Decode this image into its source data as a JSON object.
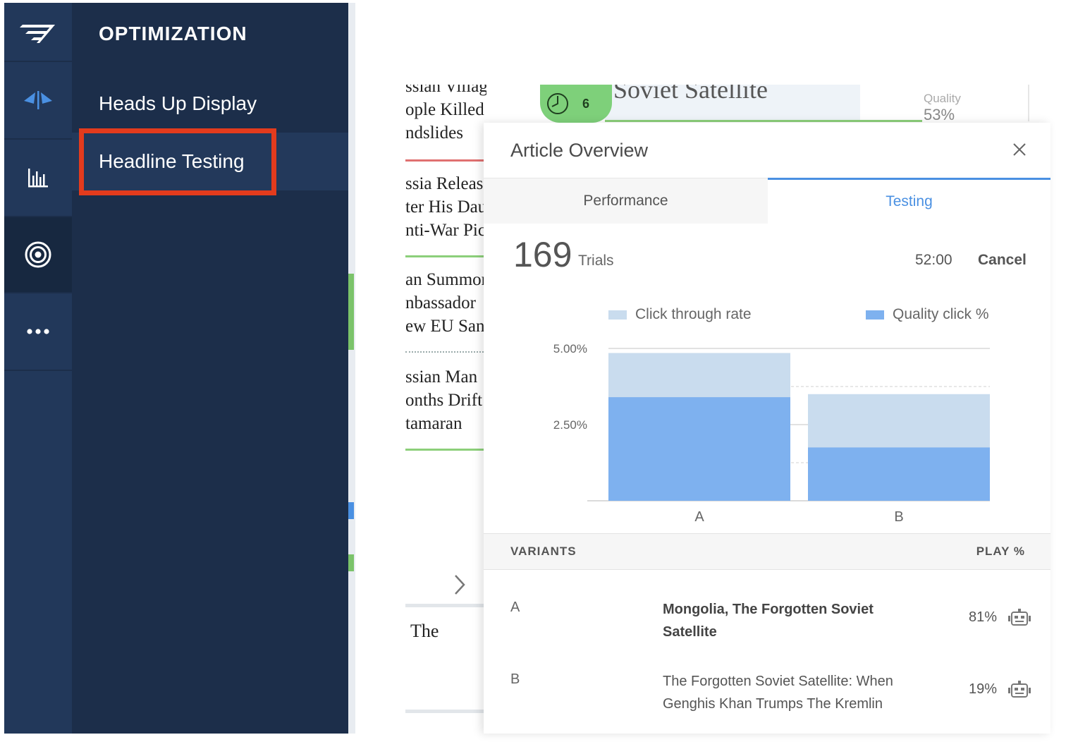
{
  "nav": {
    "section_title": "OPTIMIZATION",
    "items": [
      {
        "label": "Heads Up Display"
      },
      {
        "label": "Headline Testing"
      }
    ]
  },
  "background": {
    "list_rows": [
      [
        "ssian Village Buried In",
        "ople Killed In Floods",
        "ndslides"
      ],
      [
        "ssia Releases",
        "ter His Dau",
        "nti-War Pic"
      ],
      [
        "an Summons",
        "nbassador",
        "ew EU Sanc"
      ],
      [
        "ssian Man",
        "onths Drift",
        "tamaran"
      ]
    ],
    "the_text": "The",
    "article_title": "Soviet Satellite",
    "quality_label": "Quality",
    "quality_value": "53%",
    "timer_count": "6"
  },
  "panel": {
    "title": "Article Overview",
    "tabs": [
      {
        "label": "Performance",
        "active": false
      },
      {
        "label": "Testing",
        "active": true
      }
    ],
    "trials_count": "169",
    "trials_label": "Trials",
    "time_remaining": "52:00",
    "cancel_label": "Cancel",
    "variants_header": "VARIANTS",
    "play_header": "PLAY %",
    "variants": [
      {
        "id": "A",
        "headline": "Mongolia, The Forgotten Soviet Satellite",
        "play": "81%",
        "leading": true
      },
      {
        "id": "B",
        "headline": "The Forgotten Soviet Satellite: When Genghis Khan Trumps The Kremlin",
        "play": "19%",
        "leading": false
      }
    ]
  },
  "colors": {
    "sidebar": "#1c2e4a",
    "highlight": "#e33b1d",
    "accent": "#4a90e2",
    "ctr_bar": "#c9dcee",
    "quality_bar": "#7eb1ef",
    "timer_green": "#7ed07a"
  },
  "chart_data": {
    "type": "bar",
    "stacked": false,
    "categories": [
      "A",
      "B"
    ],
    "series": [
      {
        "name": "Click through rate",
        "values": [
          4.85,
          3.5
        ]
      },
      {
        "name": "Quality click %",
        "values": [
          3.4,
          1.75
        ]
      }
    ],
    "yticks": [
      "5.00%",
      "2.50%"
    ],
    "ylim": [
      0,
      5.0
    ],
    "legend": "top",
    "grid": true
  }
}
